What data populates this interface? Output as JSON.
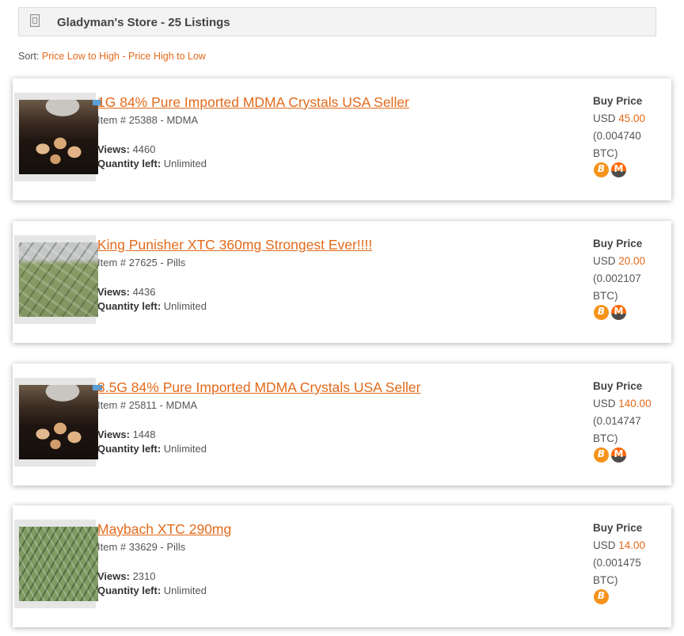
{
  "store": {
    "title": "Gladyman's Store - 25 Listings",
    "icon": "store-icon"
  },
  "sort": {
    "label": "Sort:",
    "low_to_high": "Price Low to High",
    "separator": "-",
    "high_to_low": "Price High to Low"
  },
  "listings": [
    {
      "title": "1G 84% Pure Imported MDMA Crystals USA Seller",
      "meta": "Item # 25388 - MDMA",
      "views_label": "Views:",
      "views": "4460",
      "qty_label": "Quantity left:",
      "qty": "Unlimited",
      "price_label": "Buy Price",
      "price_currency": "USD",
      "price_usd": "45.00",
      "price_btc_line1": "(0.004740",
      "price_btc_line2": "BTC)",
      "coins": [
        "bitcoin-icon",
        "monero-icon"
      ]
    },
    {
      "title": "King Punisher XTC 360mg Strongest Ever!!!!",
      "meta": "Item # 27625 - Pills",
      "views_label": "Views:",
      "views": "4436",
      "qty_label": "Quantity left:",
      "qty": "Unlimited",
      "price_label": "Buy Price",
      "price_currency": "USD",
      "price_usd": "20.00",
      "price_btc_line1": "(0.002107",
      "price_btc_line2": "BTC)",
      "coins": [
        "bitcoin-icon",
        "monero-icon"
      ]
    },
    {
      "title": "3.5G 84% Pure Imported MDMA Crystals USA Seller",
      "meta": "Item # 25811 - MDMA",
      "views_label": "Views:",
      "views": "1448",
      "qty_label": "Quantity left:",
      "qty": "Unlimited",
      "price_label": "Buy Price",
      "price_currency": "USD",
      "price_usd": "140.00",
      "price_btc_line1": "(0.014747",
      "price_btc_line2": "BTC)",
      "coins": [
        "bitcoin-icon",
        "monero-icon"
      ]
    },
    {
      "title": "Maybach XTC 290mg",
      "meta": "Item # 33629 - Pills",
      "views_label": "Views:",
      "views": "2310",
      "qty_label": "Quantity left:",
      "qty": "Unlimited",
      "price_label": "Buy Price",
      "price_currency": "USD",
      "price_usd": "14.00",
      "price_btc_line1": "(0.001475",
      "price_btc_line2": "BTC)",
      "coins": [
        "bitcoin-icon"
      ]
    }
  ],
  "colors": {
    "accent": "#e26a1b",
    "bitcoin": "#f7931a",
    "monero": "#ff6600"
  }
}
